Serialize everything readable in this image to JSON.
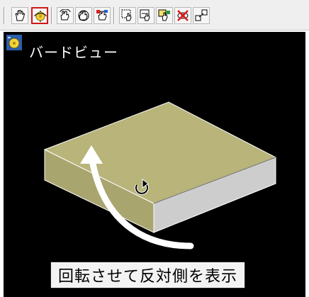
{
  "toolbar": {
    "buttons": [
      {
        "icon": "pan-hand-icon"
      },
      {
        "icon": "orbit-icon",
        "selected": true,
        "highlight_color": "#d01818"
      },
      {
        "icon": "constrained-orbit-icon"
      },
      {
        "icon": "free-orbit-icon"
      },
      {
        "icon": "continuous-orbit-icon"
      },
      {
        "icon": "zoom-window-icon"
      },
      {
        "icon": "zoom-previous-icon"
      },
      {
        "icon": "zoom-extents-icon"
      },
      {
        "icon": "clipping-plane-icon"
      },
      {
        "icon": "adjust-distance-icon"
      }
    ]
  },
  "viewport": {
    "title": "バードビュー",
    "background": "#000000",
    "box_top_color": "#b8b47a",
    "box_side_color": "#cdcdcd",
    "arrow_color": "#ffffff",
    "rotate_cursor_icon": "rotate-cursor-icon"
  },
  "caption": {
    "text": "回転させて反対側を表示"
  }
}
